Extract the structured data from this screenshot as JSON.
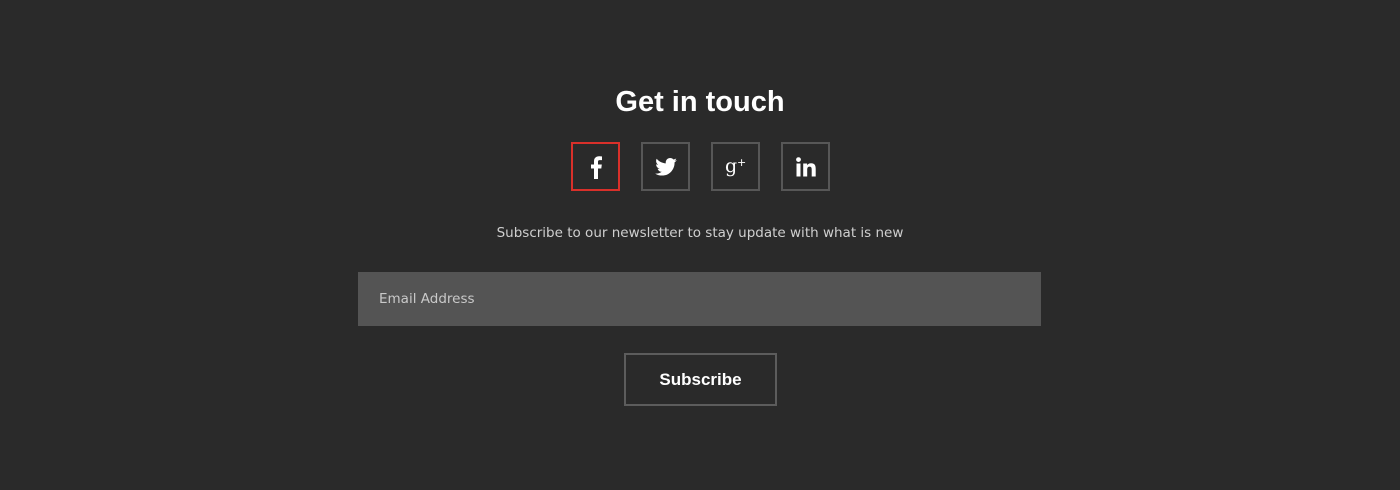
{
  "contact": {
    "title": "Get in touch",
    "subtitle": "Subscribe to our newsletter to stay update with what is new"
  },
  "socials": [
    {
      "name": "facebook",
      "icon": "facebook-icon",
      "active": true
    },
    {
      "name": "twitter",
      "icon": "twitter-icon",
      "active": false
    },
    {
      "name": "google-plus",
      "icon": "google-plus-icon",
      "active": false
    },
    {
      "name": "linkedin",
      "icon": "linkedin-icon",
      "active": false
    }
  ],
  "newsletter": {
    "email_placeholder": "Email Address",
    "email_value": "",
    "subscribe_label": "Subscribe"
  },
  "colors": {
    "background": "#2a2a2a",
    "active_border": "#d9302a",
    "border": "#575757",
    "input_background": "#545454"
  }
}
